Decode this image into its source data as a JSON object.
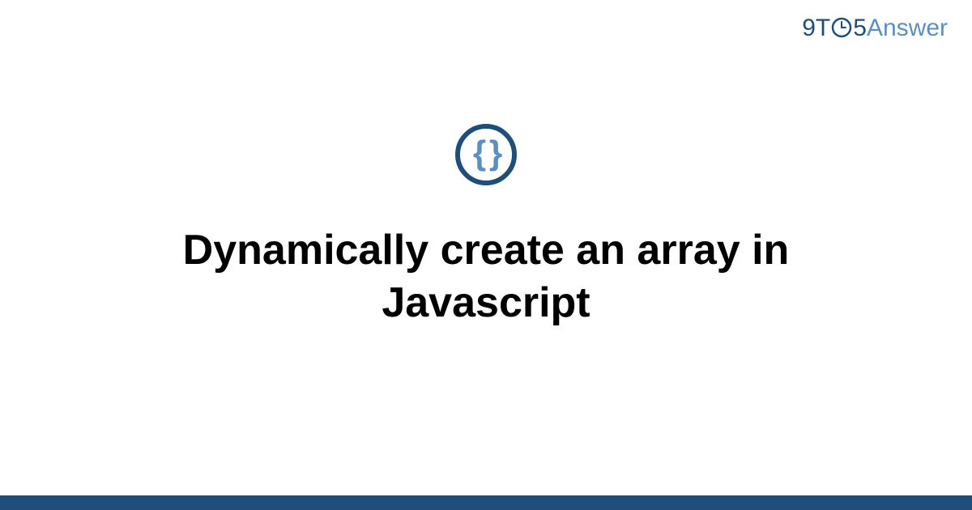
{
  "logo": {
    "part1": "9T",
    "part2": "5",
    "part3": "Answer"
  },
  "icon": {
    "braces": "{ }"
  },
  "title": "Dynamically create an array in Javascript",
  "colors": {
    "primary": "#1d4f7a",
    "secondary": "#5a8fc4"
  }
}
